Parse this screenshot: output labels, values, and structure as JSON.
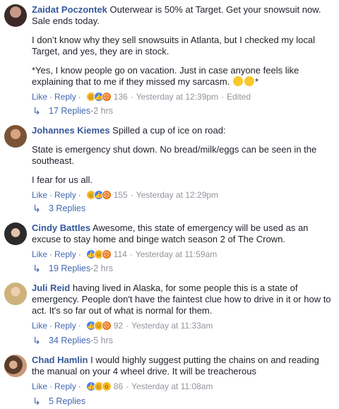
{
  "comments": [
    {
      "name": "Zaidat Poczontek",
      "paragraphs": [
        "Outerwear is 50% at Target. Get your snowsuit now. Sale ends today.",
        "I don’t know why they sell snowsuits in Atlanta, but I checked my local Target, and yes, they are in stock.",
        "*Yes, I know people go on vacation. Just in case anyone feels like explaining that to me if they missed my sarcasm."
      ],
      "trailing_mark": "*",
      "like": "Like",
      "reply": "Reply",
      "reaction_icons": [
        "haha-icon",
        "like-icon",
        "angry-icon"
      ],
      "reaction_count": "136",
      "time": "Yesterday at 12:39pm",
      "edited": "Edited",
      "replies_label": "17 Replies",
      "replies_time": "2 hrs"
    },
    {
      "name": "Johannes Kiemes",
      "paragraphs": [
        "Spilled a cup of ice on road:",
        "State is emergency shut down. No bread/milk/eggs can be seen in the southeast.",
        "I fear for us all."
      ],
      "like": "Like",
      "reply": "Reply",
      "reaction_icons": [
        "haha-icon",
        "like-icon",
        "angry-icon"
      ],
      "reaction_count": "155",
      "time": "Yesterday at 12:29pm",
      "replies_label": "3 Replies"
    },
    {
      "name": "Cindy Battles",
      "paragraphs": [
        "Awesome, this state of emergency will be used as an excuse to stay home and binge watch season 2 of The Crown."
      ],
      "like": "Like",
      "reply": "Reply",
      "reaction_icons": [
        "like-icon",
        "haha-icon",
        "angry-icon"
      ],
      "reaction_count": "114",
      "time": "Yesterday at 11:59am",
      "replies_label": "19 Replies",
      "replies_time": "2 hrs"
    },
    {
      "name": "Juli Reid",
      "paragraphs": [
        "having lived in Alaska, for some people this is a state of emergency. People don't have the faintest clue how to drive in it or how to act. It's so far out of what is normal for them."
      ],
      "like": "Like",
      "reply": "Reply",
      "reaction_icons": [
        "like-icon",
        "haha-icon",
        "angry-icon"
      ],
      "reaction_count": "92",
      "time": "Yesterday at 11:33am",
      "replies_label": "34 Replies",
      "replies_time": "5 hrs"
    },
    {
      "name": "Chad Hamlin",
      "paragraphs": [
        "I would highly suggest putting the chains on and reading the manual on your 4 wheel drive. It will be treacherous"
      ],
      "like": "Like",
      "reply": "Reply",
      "reaction_icons": [
        "like-icon",
        "haha-icon",
        "wow-icon"
      ],
      "reaction_count": "86",
      "time": "Yesterday at 11:08am",
      "replies_label": "5 Replies"
    }
  ],
  "colors": {
    "name": "#365899",
    "link": "#4267b2",
    "meta": "#90949c",
    "text": "#1d2129"
  }
}
